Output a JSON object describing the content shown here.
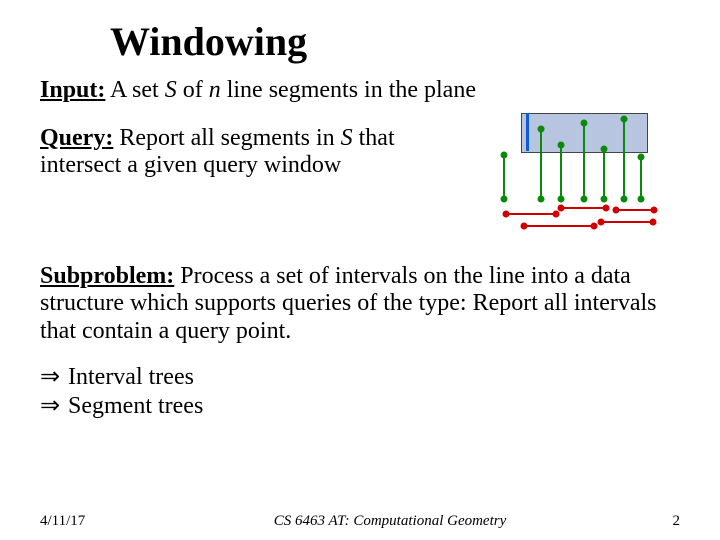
{
  "title": "Windowing",
  "input": {
    "label": "Input",
    "text_before": " A set ",
    "S": "S",
    "text_mid": " of ",
    "n": "n",
    "text_after": " line segments in the plane"
  },
  "query": {
    "label": "Query",
    "text_before": " Report all segments in ",
    "S": "S",
    "text_after": " that intersect a given query window"
  },
  "subproblem": {
    "label": "Subproblem",
    "text": " Process a set of intervals on the line into a data structure which supports queries of the type: Report all intervals that contain a query point."
  },
  "bullets": {
    "arrow": "⇒",
    "item1": "Interval trees",
    "item2": "Segment trees"
  },
  "footer": {
    "date": "4/11/17",
    "course": "CS 6463 AT: Computational Geometry",
    "page": "2"
  }
}
